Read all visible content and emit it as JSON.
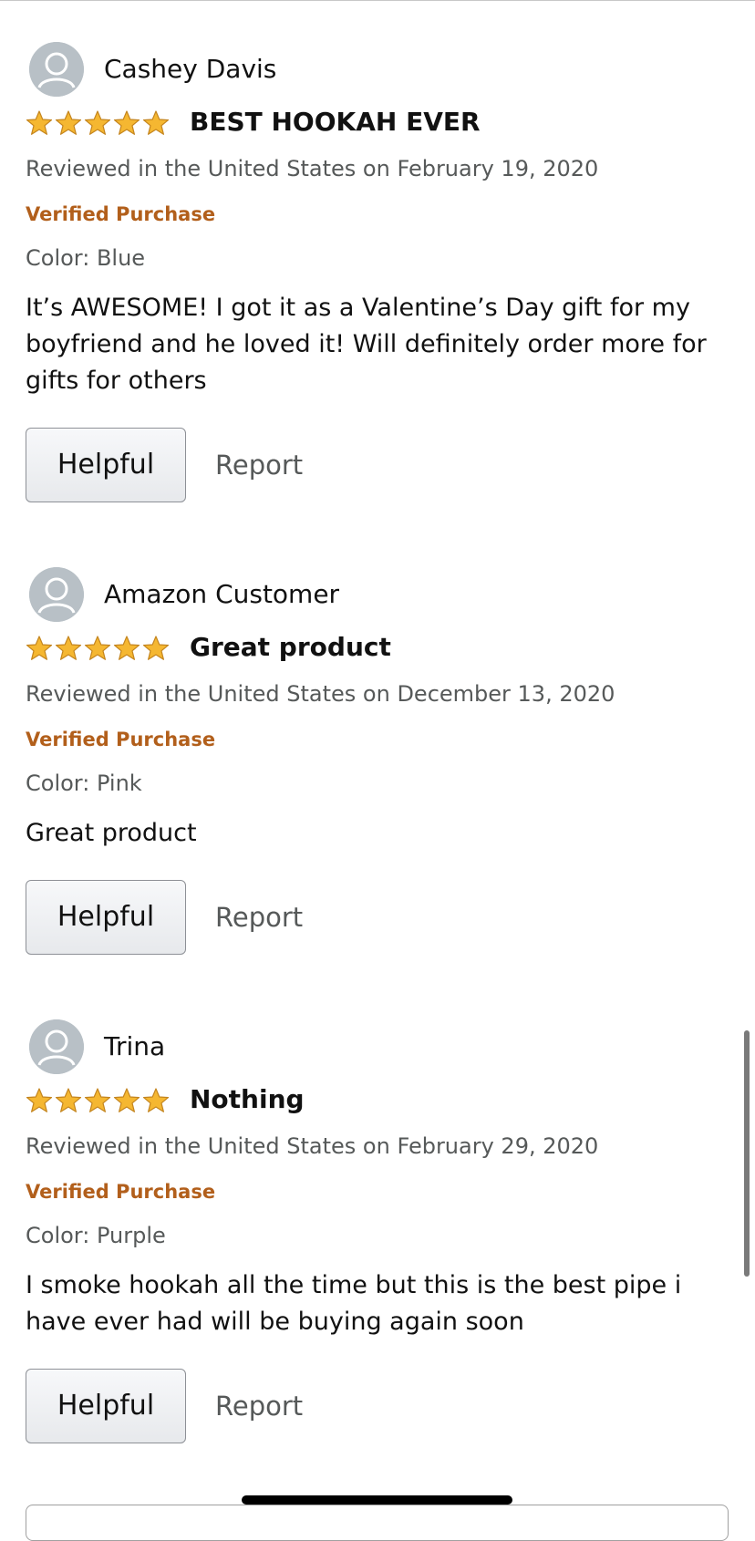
{
  "reviews": [
    {
      "author": "Cashey Davis",
      "rating": 5,
      "title": "BEST HOOKAH EVER",
      "meta": "Reviewed in the United States on February 19, 2020",
      "verified": "Verified Purchase",
      "color": "Color: Blue",
      "body": "It’s AWESOME! I got it as a Valentine’s Day gift for my boyfriend and he loved it! Will definitely order more for gifts for others",
      "helpful_label": "Helpful",
      "report_label": "Report"
    },
    {
      "author": "Amazon Customer",
      "rating": 5,
      "title": "Great product",
      "meta": "Reviewed in the United States on December 13, 2020",
      "verified": "Verified Purchase",
      "color": "Color: Pink",
      "body": "Great product",
      "helpful_label": "Helpful",
      "report_label": "Report"
    },
    {
      "author": "Trina",
      "rating": 5,
      "title": "Nothing",
      "meta": "Reviewed in the United States on February 29, 2020",
      "verified": "Verified Purchase",
      "color": "Color: Purple",
      "body": "I smoke hookah all the time but this is the best pipe i have ever had will be buying again soon",
      "helpful_label": "Helpful",
      "report_label": "Report"
    }
  ],
  "icons": {
    "avatar": "user-avatar-icon",
    "star": "star-icon"
  },
  "colors": {
    "star_fill": "#f5b731",
    "star_stroke": "#c4851f",
    "verified": "#b25f1b",
    "meta": "#565959"
  }
}
